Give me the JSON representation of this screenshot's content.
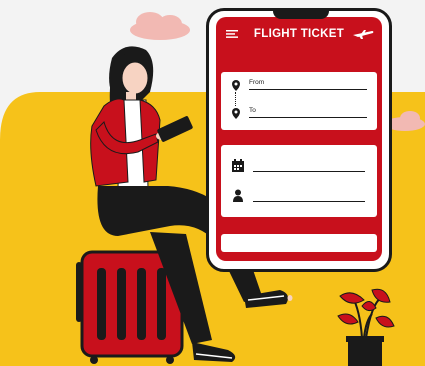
{
  "app": {
    "title": "FLIGHT TICKET",
    "menu_icon": "hamburger-menu-icon",
    "brand_icon": "airplane-icon"
  },
  "route": {
    "from_label": "From",
    "to_label": "To"
  },
  "colors": {
    "brand_red": "#c8101c",
    "accent_yellow": "#f6c21a",
    "outline": "#1a1a1a",
    "cloud_pink": "#f2b9b3"
  }
}
